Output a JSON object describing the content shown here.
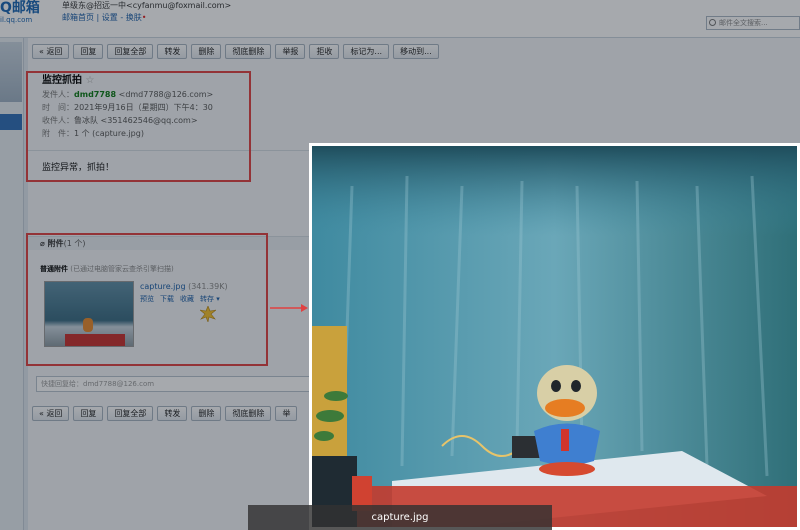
{
  "header": {
    "logo_text": "Q邮箱",
    "logo_sub": "il.qq.com",
    "account_line": "单级东@招远一中<cyfanmu@foxmail.com>",
    "links": "邮箱首页 | 设置 - 换肤",
    "search_placeholder": "邮件全文搜索..."
  },
  "toolbar": {
    "buttons": [
      "« 返回",
      "回复",
      "回复全部",
      "转发",
      "删除",
      "彻底删除",
      "举报",
      "拒收",
      "标记为...",
      "移动到..."
    ]
  },
  "toolbar_bottom": {
    "buttons": [
      "« 返回",
      "回复",
      "回复全部",
      "转发",
      "删除",
      "彻底删除",
      "举"
    ]
  },
  "email": {
    "subject": "监控抓拍",
    "star": "☆",
    "sender_label": "发件人：",
    "sender_name": "dmd7788",
    "sender_addr": "<dmd7788@126.com>",
    "time_label": "时　间：",
    "time_value": "2021年9月16日（星期四）下午4：30",
    "to_label": "收件人：",
    "to_value": "鲁冰队 <35146254​6@qq.com>",
    "attach_label": "附　件：",
    "attach_value": "1 个 (capture.jpg)",
    "body": "监控异常，抓拍！"
  },
  "attachment": {
    "title": "附件",
    "count": "(1 个)",
    "sub_bold": "普通附件",
    "sub_note": "(已通过电脑管家云查杀引擎扫描)",
    "file_name": "capture.jpg",
    "file_size": "(341.39K)",
    "actions": [
      "预览",
      "下载",
      "收藏",
      "转存 ▾"
    ]
  },
  "reply_placeholder": "快捷回复给：dmd7788@126.com",
  "viewer": {
    "caption": "capture.jpg"
  },
  "colors": {
    "annotation_red": "#e04141",
    "link_blue": "#1a5ea8",
    "sender_green": "#0c7a14"
  }
}
